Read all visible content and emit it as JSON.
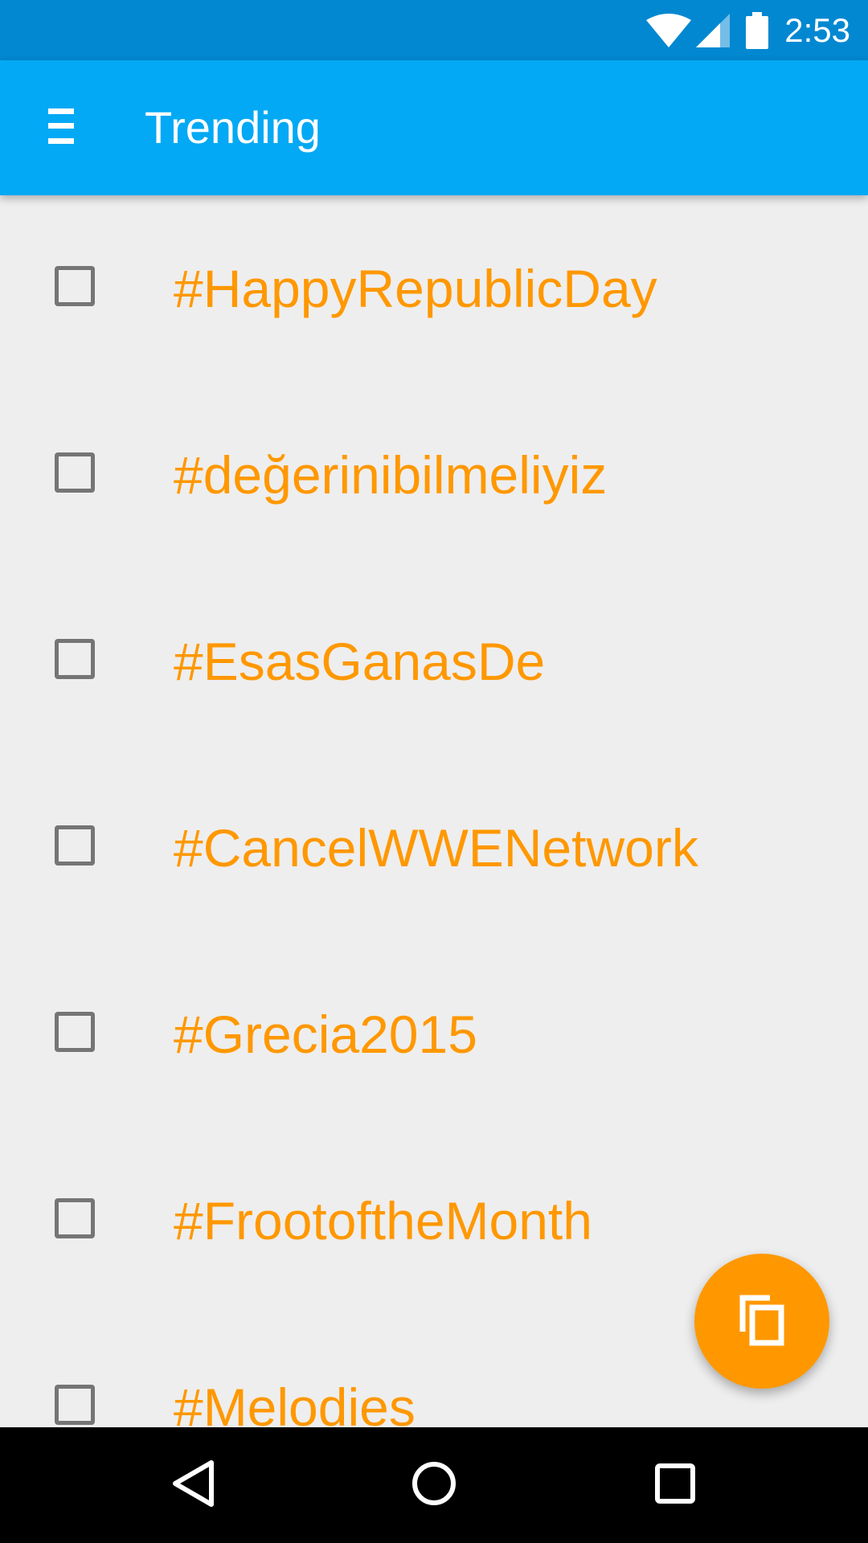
{
  "status_bar": {
    "time": "2:53",
    "icons": [
      "wifi-icon",
      "cell-signal-icon",
      "battery-icon"
    ],
    "background": "#0288d1"
  },
  "app_bar": {
    "title": "Trending",
    "menu_icon": "menu-icon",
    "background": "#03a9f4"
  },
  "list": {
    "accent": "#ff9800",
    "items": [
      {
        "label": "#HappyRepublicDay",
        "checked": false
      },
      {
        "label": "#değerinibilmeliyiz",
        "checked": false
      },
      {
        "label": "#EsasGanasDe",
        "checked": false
      },
      {
        "label": "#CancelWWENetwork",
        "checked": false
      },
      {
        "label": "#Grecia2015",
        "checked": false
      },
      {
        "label": "#FrootoftheMonth",
        "checked": false
      },
      {
        "label": "#Melodies",
        "checked": false
      }
    ]
  },
  "fab": {
    "icon": "copy-icon",
    "color": "#ff9800"
  },
  "nav_bar": {
    "buttons": [
      "back-icon",
      "home-icon",
      "recents-icon"
    ]
  }
}
